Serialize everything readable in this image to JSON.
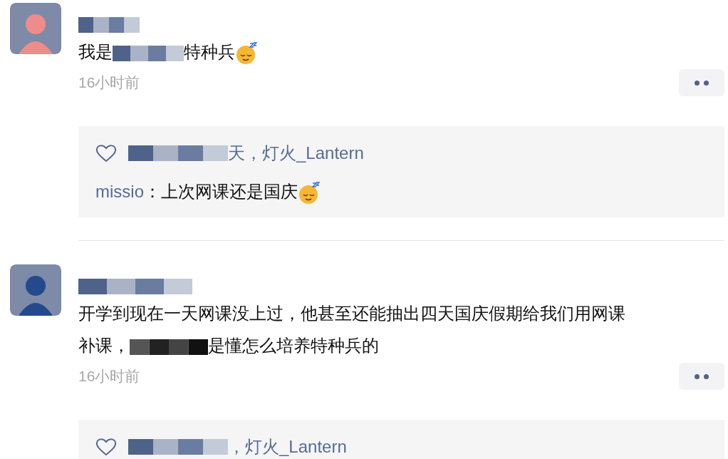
{
  "comments": [
    {
      "avatar": {
        "color": "#ee8c8c"
      },
      "segments": [
        {
          "kind": "text",
          "text": "我是"
        },
        {
          "kind": "mosaic"
        },
        {
          "kind": "text",
          "text": "特种兵"
        },
        {
          "kind": "emoji"
        }
      ],
      "time": "16小时前",
      "likes": [
        {
          "kind": "mosaic"
        },
        {
          "kind": "text",
          "text": "天，灯火_Lantern"
        }
      ],
      "replies": [
        {
          "author": "missio",
          "text": "：上次网课还是国庆",
          "emoji": true
        }
      ]
    },
    {
      "avatar": {
        "color": "#234a8c"
      },
      "segments": [
        {
          "kind": "text",
          "text": "开学到现在一天网课没上过，他甚至还能抽出四天国庆假期给我们用网课"
        },
        {
          "kind": "break"
        },
        {
          "kind": "text",
          "text": "补课，"
        },
        {
          "kind": "mosaic"
        },
        {
          "kind": "text",
          "text": "是懂怎么培养特种兵的"
        }
      ],
      "time": "16小时前",
      "likes": [
        {
          "kind": "mosaic"
        },
        {
          "kind": "text",
          "text": "，灯火_Lantern"
        }
      ]
    }
  ]
}
